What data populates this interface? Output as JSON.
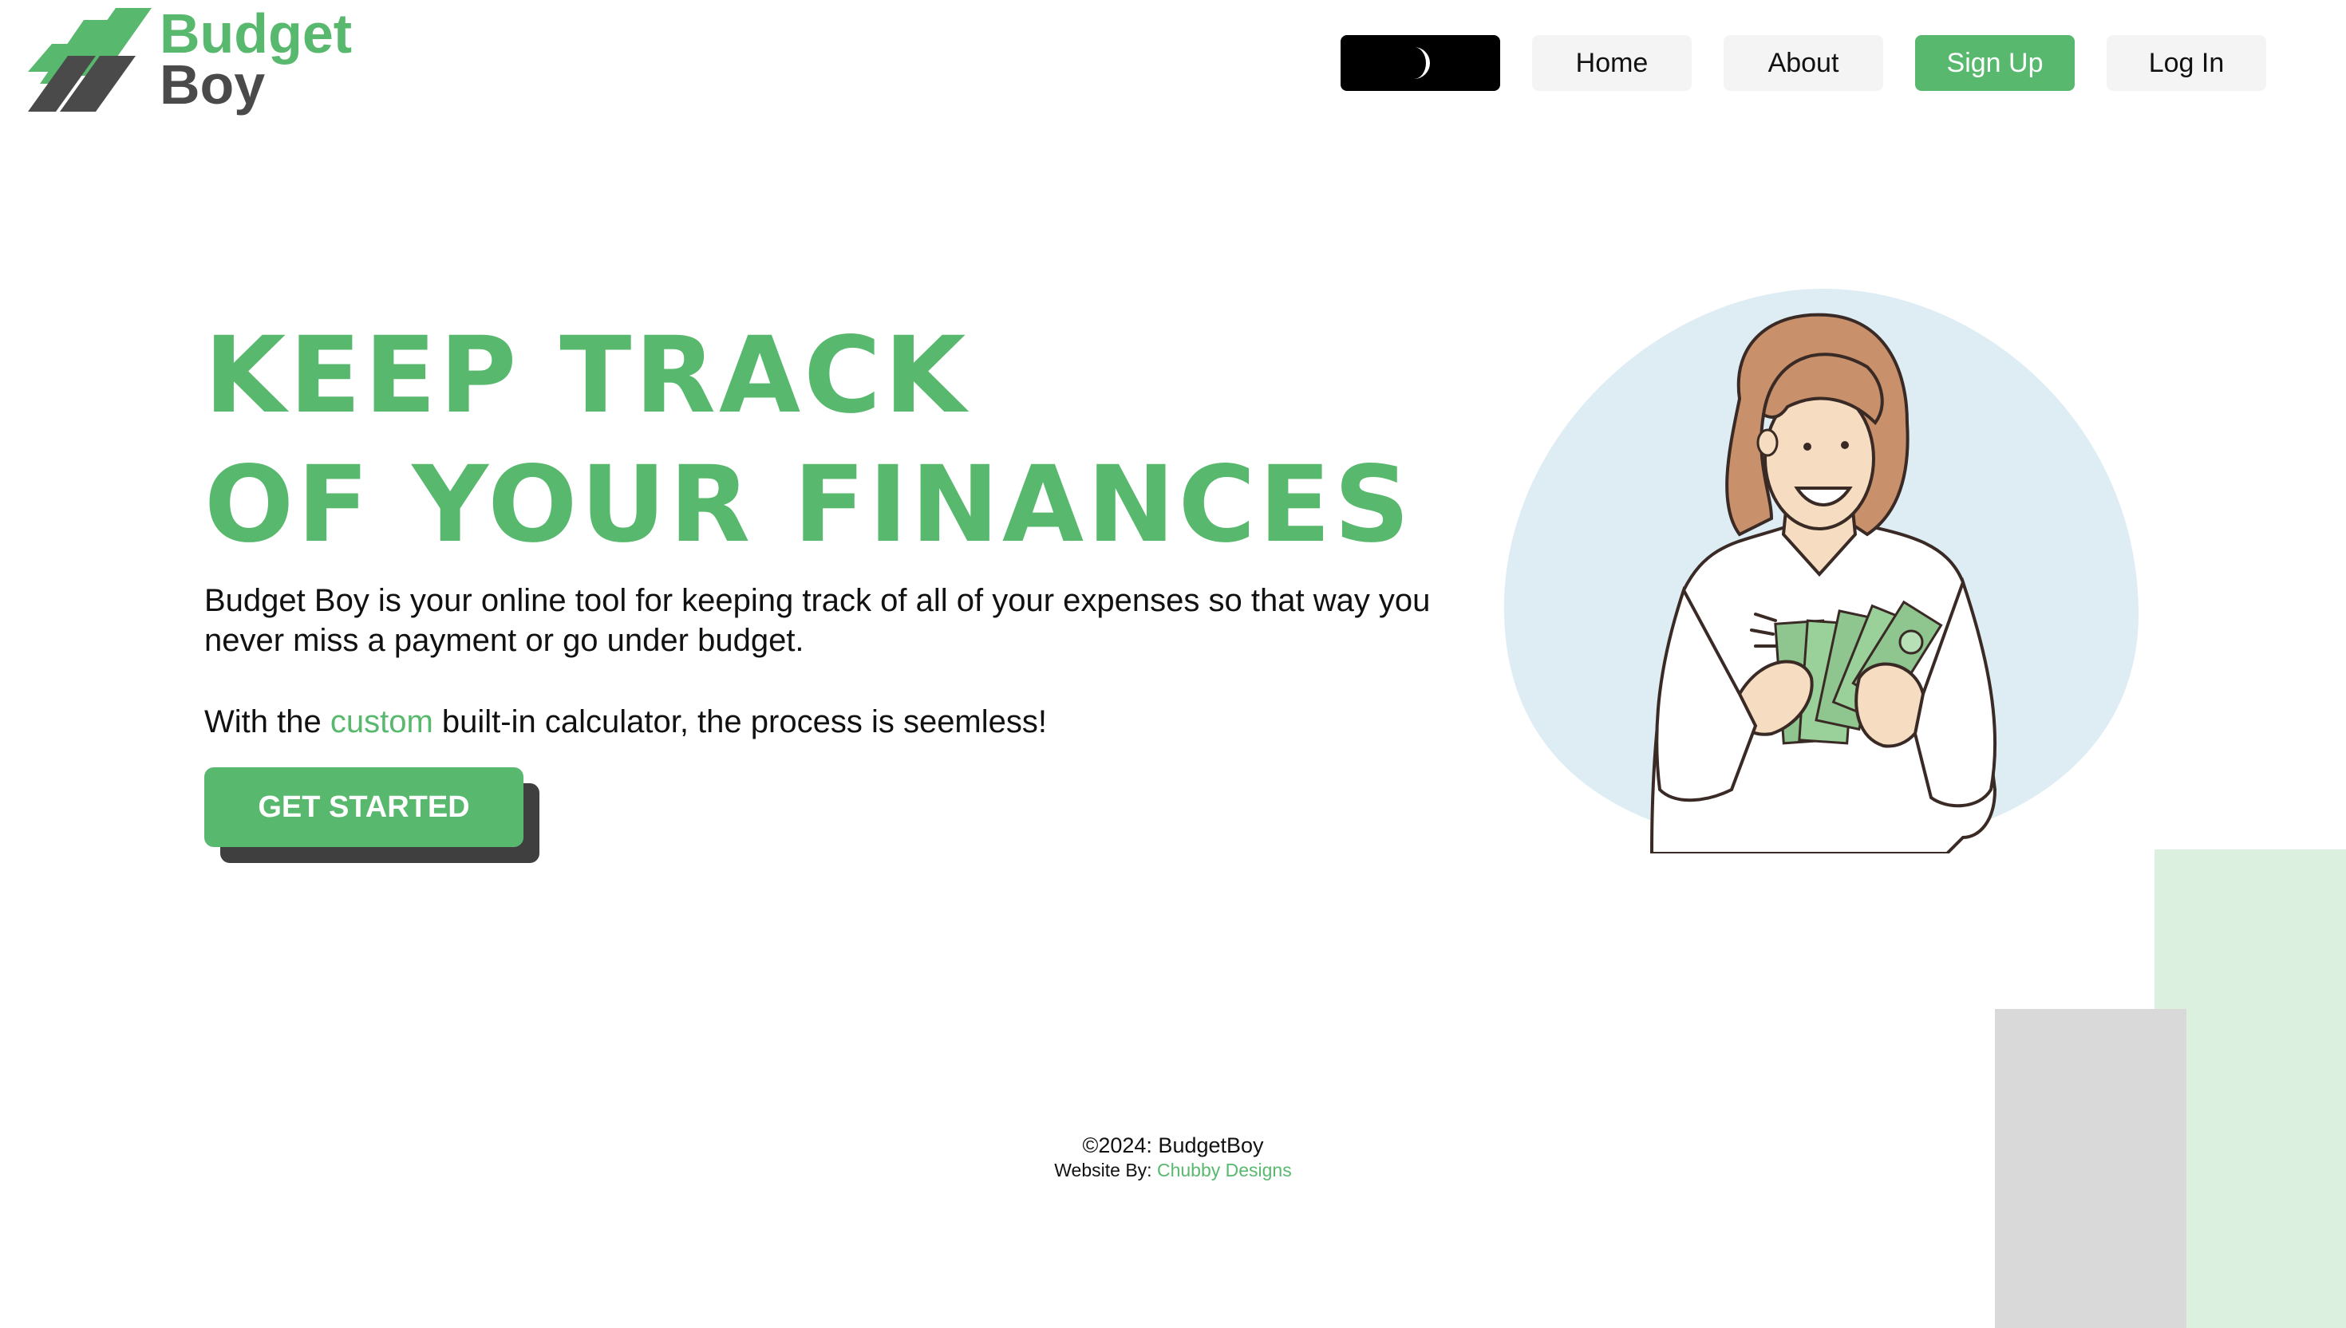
{
  "brand": {
    "name_top": "Budget",
    "name_bottom": "Boy",
    "primary_color": "#58b96e",
    "dark_color": "#4a4a4a"
  },
  "nav": {
    "theme_toggle_icon": "moon-icon",
    "items": [
      {
        "label": "Home"
      },
      {
        "label": "About"
      },
      {
        "label": "Sign Up"
      },
      {
        "label": "Log In"
      }
    ]
  },
  "hero": {
    "headline_line1": "KEEP TRACK",
    "headline_line2": "OF YOUR FINANCES",
    "description": "Budget Boy is your online tool for keeping track of all of your expenses so that way you never miss a payment or go under budget.",
    "calc_prefix": "With the ",
    "calc_accent": "custom",
    "calc_suffix": " built-in calculator, the process is seemless!",
    "cta_label": "GET STARTED",
    "illustration": "woman-counting-money-illustration"
  },
  "footer": {
    "copyright": "©2024: BudgetBoy",
    "credit_prefix": "Website By: ",
    "credit_link": "Chubby Designs"
  }
}
